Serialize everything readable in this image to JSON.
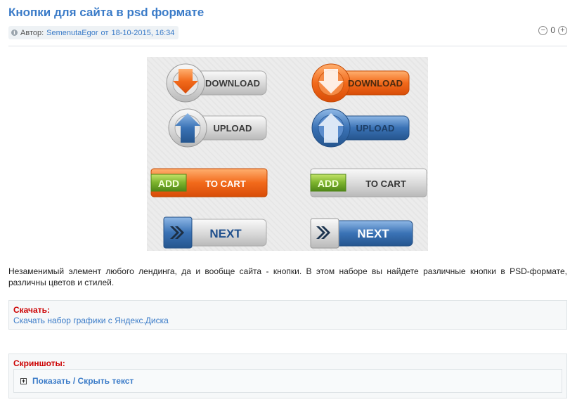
{
  "article": {
    "title": "Кнопки для сайта в psd формате",
    "meta": {
      "author_prefix": "Автор:",
      "author_name": "SemenutaEgor",
      "date_prefix": "от",
      "date": "18-10-2015, 16:34"
    },
    "rating": {
      "minus": "−",
      "value": "0",
      "plus": "+"
    },
    "preview_buttons": {
      "download": "DOWNLOAD",
      "upload": "UPLOAD",
      "add": "ADD",
      "to_cart": "TO CART",
      "next": "NEXT"
    },
    "description": "Незаменимый элемент любого лендинга, да и вообще сайта - кнопки. В этом наборе вы найдете различные кнопки в PSD-формате, различны цветов и стилей.",
    "download_box": {
      "title": "Скачать:",
      "link": "Скачать набор графики с Яндекс.Диска"
    },
    "screens_box": {
      "title": "Скриншоты:",
      "toggle_label": "Показать / Скрыть текст",
      "toggle_icon": "⊞"
    }
  },
  "colors": {
    "accent": "#3a7bc8",
    "orange": "#f26a1b",
    "blue": "#3a72b5",
    "green": "#7cb32d",
    "red_label": "#cc0000"
  }
}
